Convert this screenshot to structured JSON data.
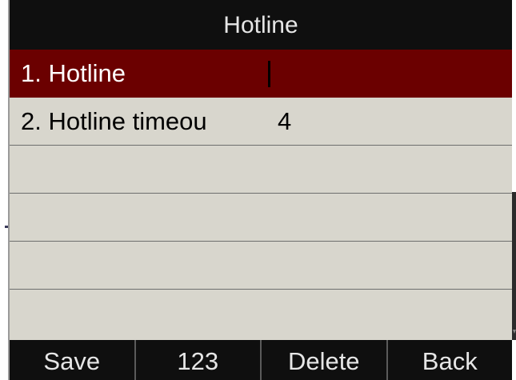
{
  "title": "Hotline",
  "rows": [
    {
      "label": "1. Hotline",
      "value": "",
      "selected": true
    },
    {
      "label": "2. Hotline timeou",
      "value": "4",
      "selected": false
    },
    {
      "label": "",
      "value": "",
      "selected": false
    },
    {
      "label": "",
      "value": "",
      "selected": false
    },
    {
      "label": "",
      "value": "",
      "selected": false
    },
    {
      "label": "",
      "value": "",
      "selected": false
    }
  ],
  "softkeys": {
    "save": "Save",
    "mode": "123",
    "delete": "Delete",
    "back": "Back"
  },
  "colors": {
    "selected_row": "#6b0000",
    "background": "#d8d6cd",
    "bars": "#0f0f0f"
  }
}
